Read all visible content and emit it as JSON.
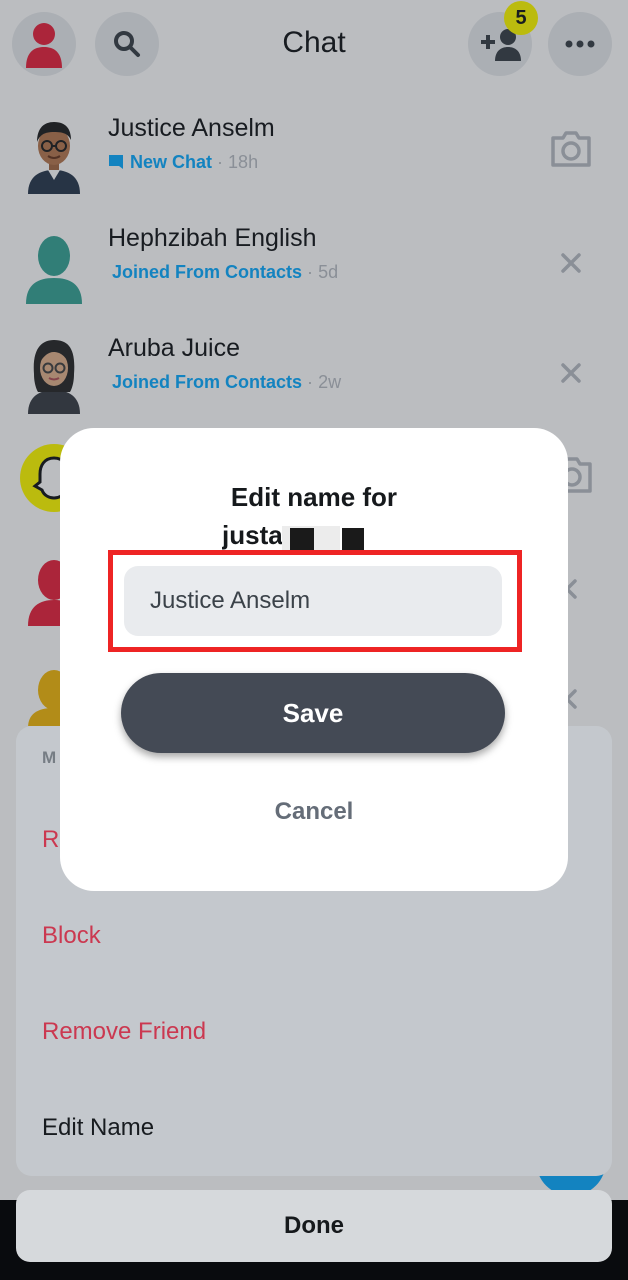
{
  "header": {
    "title": "Chat",
    "friend_requests_count": "5",
    "icons": {
      "profile": "bitmoji-avatar-icon",
      "search": "search-icon",
      "add_friend": "add-friend-icon",
      "more": "more-dots-icon"
    }
  },
  "conversations": [
    {
      "name": "Justice Anselm",
      "status": "New Chat",
      "time": "18h",
      "action_icon": "camera-icon"
    },
    {
      "name": "Hephzibah English",
      "status": "Joined From Contacts",
      "time": "5d",
      "action_icon": "close-icon"
    },
    {
      "name": "Aruba Juice",
      "status": "Joined From Contacts",
      "time": "2w",
      "action_icon": "close-icon"
    }
  ],
  "separator": "·",
  "action_sheet": {
    "header_partial": "M",
    "items": [
      {
        "label": "R",
        "style": "red"
      },
      {
        "label": "Block",
        "style": "red"
      },
      {
        "label": "Remove Friend",
        "style": "red"
      },
      {
        "label": "Edit Name",
        "style": "dark"
      }
    ],
    "done_label": "Done"
  },
  "edit_dialog": {
    "title": "Edit name for",
    "username_visible": "justa",
    "input_value": "Justice Anselm",
    "save_label": "Save",
    "cancel_label": "Cancel"
  },
  "colors": {
    "accent_blue": "#0fadff",
    "destructive_red": "#f23c57",
    "highlight_red": "#ee2424",
    "snap_yellow": "#fffc00",
    "save_button": "#444a55"
  }
}
